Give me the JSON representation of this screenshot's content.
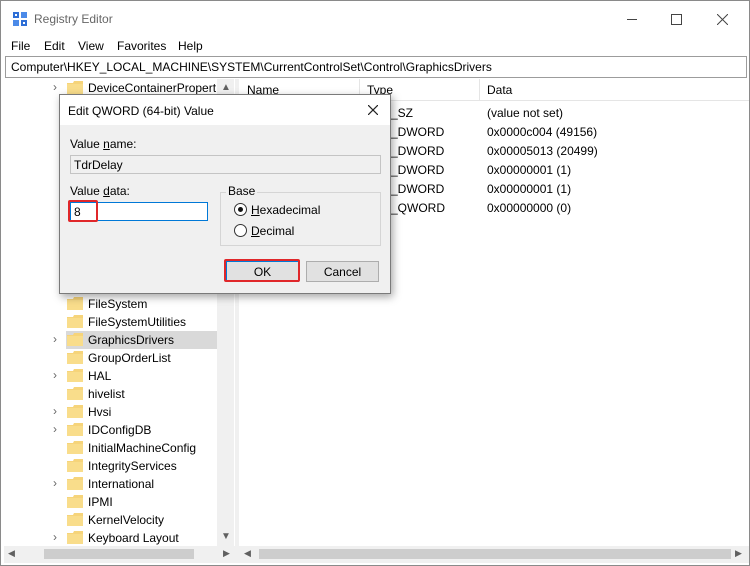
{
  "window": {
    "title": "Registry Editor",
    "menu": [
      "File",
      "Edit",
      "View",
      "Favorites",
      "Help"
    ],
    "address": "Computer\\HKEY_LOCAL_MACHINE\\SYSTEM\\CurrentControlSet\\Control\\GraphicsDrivers"
  },
  "tree": {
    "items": [
      {
        "label": "DeviceContainerPropert",
        "expandable": true
      },
      {
        "label": "FileSystem",
        "expandable": false
      },
      {
        "label": "FileSystemUtilities",
        "expandable": false
      },
      {
        "label": "GraphicsDrivers",
        "expandable": true,
        "selected": true
      },
      {
        "label": "GroupOrderList",
        "expandable": false
      },
      {
        "label": "HAL",
        "expandable": true
      },
      {
        "label": "hivelist",
        "expandable": false
      },
      {
        "label": "Hvsi",
        "expandable": true
      },
      {
        "label": "IDConfigDB",
        "expandable": true
      },
      {
        "label": "InitialMachineConfig",
        "expandable": false
      },
      {
        "label": "IntegrityServices",
        "expandable": false
      },
      {
        "label": "International",
        "expandable": true
      },
      {
        "label": "IPMI",
        "expandable": false
      },
      {
        "label": "KernelVelocity",
        "expandable": false
      },
      {
        "label": "Keyboard Layout",
        "expandable": true
      }
    ]
  },
  "list": {
    "columns": {
      "name": "Name",
      "type": "Type",
      "data": "Data"
    },
    "rows": [
      {
        "type": "_SZ",
        "data": "(value not set)"
      },
      {
        "type": "_DWORD",
        "data": "0x0000c004 (49156)"
      },
      {
        "type": "_DWORD",
        "data": "0x00005013 (20499)"
      },
      {
        "type": "_DWORD",
        "data": "0x00000001 (1)"
      },
      {
        "type": "_DWORD",
        "data": "0x00000001 (1)"
      },
      {
        "type": "_QWORD",
        "data": "0x00000000 (0)"
      }
    ]
  },
  "dialog": {
    "title": "Edit QWORD (64-bit) Value",
    "value_name_label_pre": "Value ",
    "value_name_label_key": "n",
    "value_name_label_post": "ame:",
    "value_name": "TdrDelay",
    "value_data_label_pre": "Value ",
    "value_data_label_key": "d",
    "value_data_label_post": "ata:",
    "value_data": "8",
    "base_label": "Base",
    "hex_key": "H",
    "hex_rest": "exadecimal",
    "dec_key": "D",
    "dec_rest": "ecimal",
    "base_selected": "Hexadecimal",
    "ok_label": "OK",
    "cancel_label": "Cancel"
  },
  "colors": {
    "highlight": "#e0272a",
    "focus": "#0078d7",
    "selected_row": "#d9d9d9",
    "folder": "#f6d47a"
  }
}
